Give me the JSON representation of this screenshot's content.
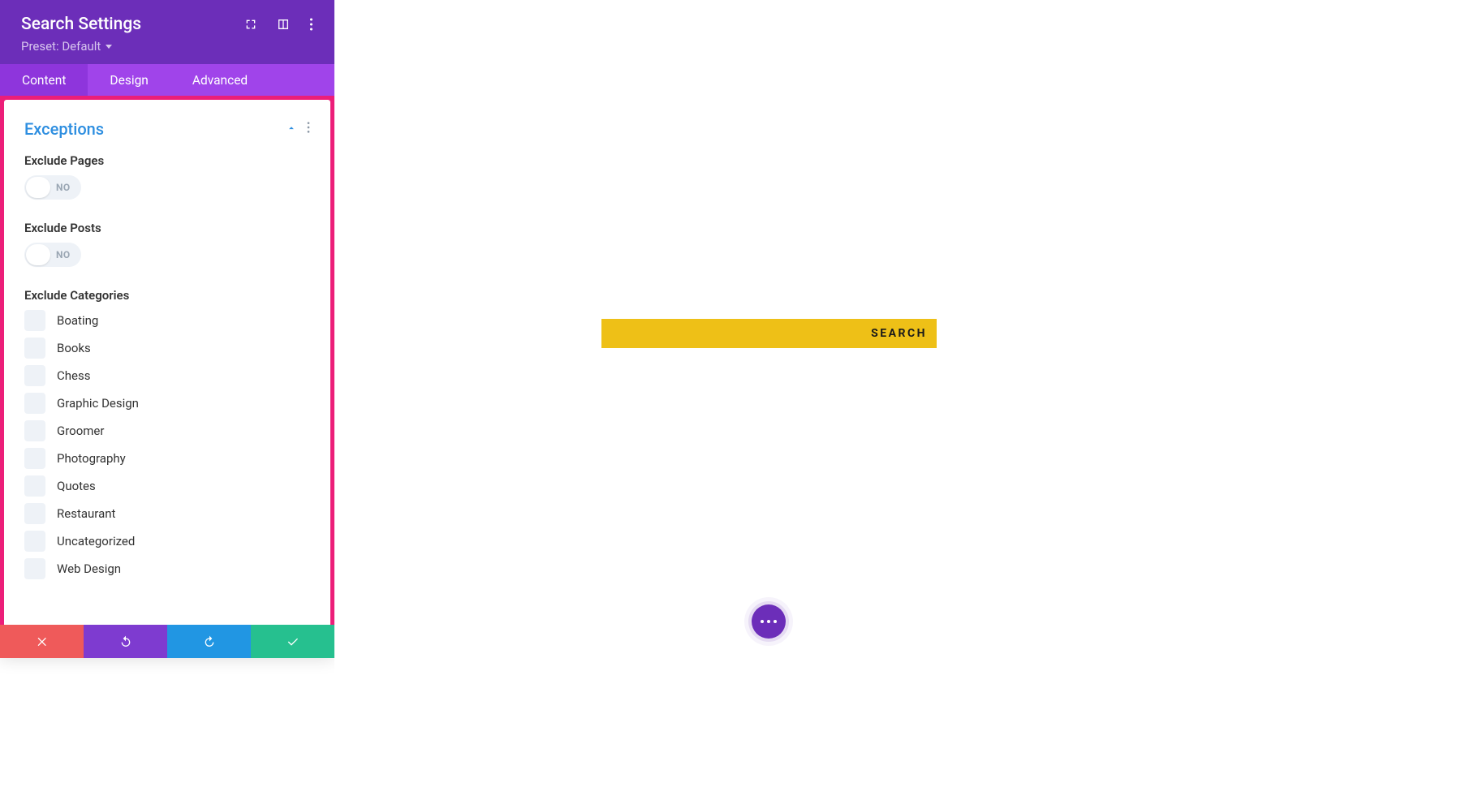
{
  "header": {
    "title": "Search Settings",
    "preset_label": "Preset: Default"
  },
  "tabs": {
    "content": "Content",
    "design": "Design",
    "advanced": "Advanced"
  },
  "section": {
    "title": "Exceptions"
  },
  "fields": {
    "exclude_pages_label": "Exclude Pages",
    "exclude_pages_state": "NO",
    "exclude_posts_label": "Exclude Posts",
    "exclude_posts_state": "NO",
    "exclude_categories_label": "Exclude Categories"
  },
  "categories": [
    "Boating",
    "Books",
    "Chess",
    "Graphic Design",
    "Groomer",
    "Photography",
    "Quotes",
    "Restaurant",
    "Uncategorized",
    "Web Design"
  ],
  "canvas": {
    "search_button": "SEARCH"
  }
}
